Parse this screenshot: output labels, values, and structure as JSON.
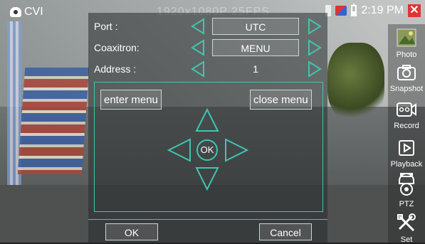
{
  "status_bar": {
    "brand": "CVI",
    "resolution": "1920x1080P 25FPS",
    "time": "2:19 PM"
  },
  "dialog": {
    "rows": [
      {
        "label": "Port :",
        "value": "UTC"
      },
      {
        "label": "Coaxitron:",
        "value": "MENU"
      },
      {
        "label": "Address :",
        "value": "1"
      }
    ],
    "enter_menu": "enter menu",
    "close_menu": "close menu",
    "ok_center": "OK",
    "ok": "OK",
    "cancel": "Cancel"
  },
  "sidebar": {
    "items": [
      {
        "label": "Photo",
        "icon": "photo-icon"
      },
      {
        "label": "Snapshot",
        "icon": "camera-icon"
      },
      {
        "label": "Record",
        "icon": "video-icon"
      },
      {
        "label": "Playback",
        "icon": "play-icon"
      },
      {
        "label": "PTZ",
        "icon": "ptz-camera-icon"
      },
      {
        "label": "Set",
        "icon": "tools-icon"
      }
    ]
  },
  "colors": {
    "accent": "#3ec6b0",
    "close_red": "#e03434"
  }
}
